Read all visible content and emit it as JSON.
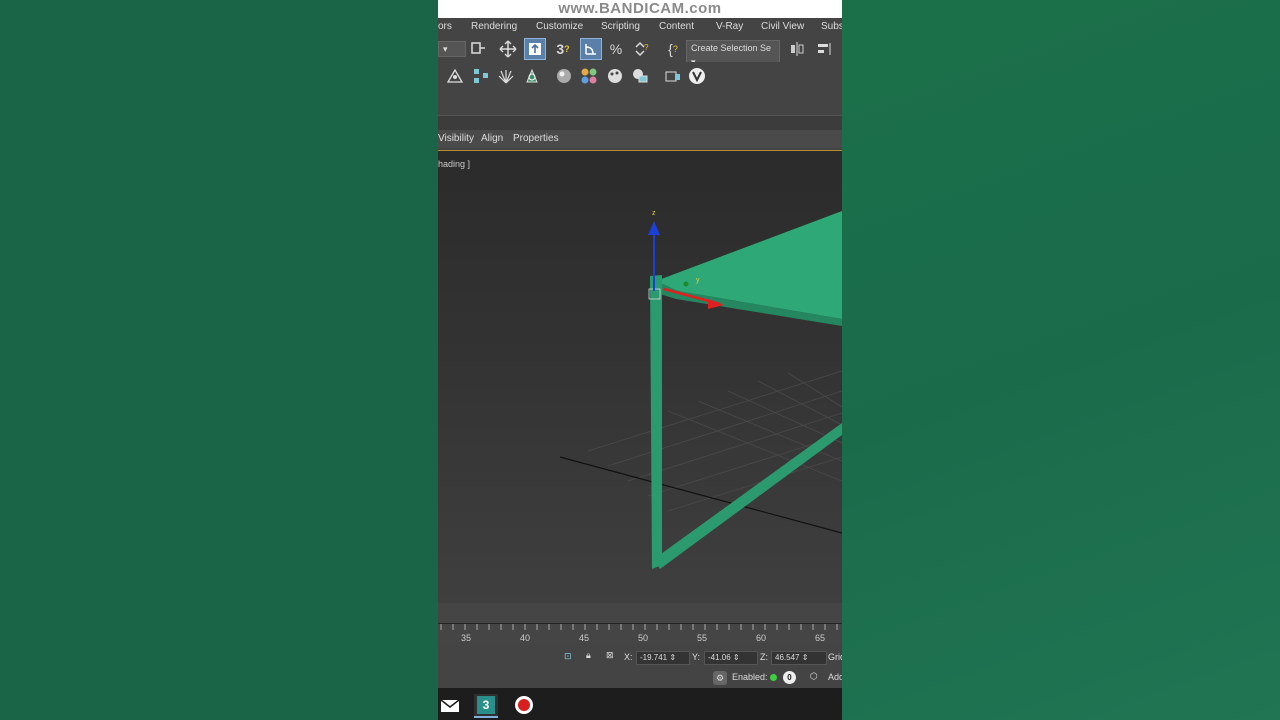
{
  "watermark": "www.BANDICAM.com",
  "menubar": {
    "items": [
      "ors",
      "Rendering",
      "Customize",
      "Scripting",
      "Content",
      "V-Ray",
      "Civil View",
      "Subs"
    ]
  },
  "toolbar": {
    "selection_set": "Create Selection Se",
    "snap_label": "3"
  },
  "ribbon_tabs": [
    "Visibility",
    "Align",
    "Properties"
  ],
  "viewport": {
    "label": "hading ]",
    "gizmo_z": "z",
    "gizmo_y": "y"
  },
  "ruler": {
    "ticks": [
      "35",
      "40",
      "45",
      "50",
      "55",
      "60",
      "65"
    ]
  },
  "status": {
    "x_label": "X:",
    "x_value": "-19.741",
    "y_label": "Y:",
    "y_value": "-41.06",
    "z_label": "Z:",
    "z_value": "46.547",
    "grid_label": "Grid",
    "enabled_label": "Enabled:",
    "enabled_count": "0",
    "add_label": "Add"
  },
  "taskbar": {
    "app_badge": "3"
  },
  "colors": {
    "object": "#2fa878",
    "accent_selected": "#5a7fa8",
    "axis_x": "#e02020",
    "axis_z": "#1c3fd8"
  }
}
